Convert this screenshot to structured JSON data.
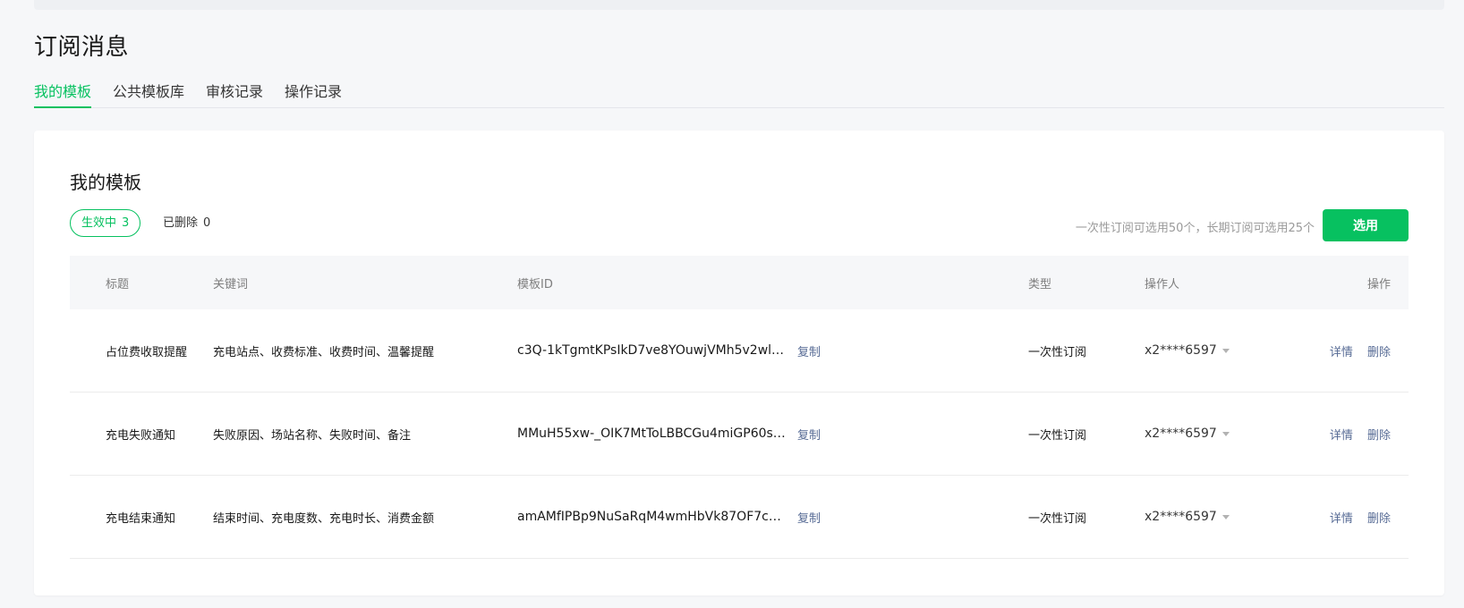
{
  "page": {
    "title": "订阅消息"
  },
  "tabs": [
    {
      "label": "我的模板",
      "active": true
    },
    {
      "label": "公共模板库",
      "active": false
    },
    {
      "label": "审核记录",
      "active": false
    },
    {
      "label": "操作记录",
      "active": false
    }
  ],
  "section": {
    "title": "我的模板",
    "filters": {
      "active": {
        "label": "生效中",
        "count": "3"
      },
      "deleted": {
        "label": "已删除",
        "count": "0"
      }
    },
    "quota_note": "一次性订阅可选用50个，长期订阅可选用25个",
    "select_button": "选用"
  },
  "table": {
    "headers": {
      "title": "标题",
      "keywords": "关键词",
      "template_id": "模板ID",
      "type": "类型",
      "operator": "操作人",
      "actions": "操作"
    },
    "copy_label": "复制",
    "detail_label": "详情",
    "delete_label": "删除",
    "rows": [
      {
        "title": "占位费收取提醒",
        "keywords": "充电站点、收费标准、收费时间、温馨提醒",
        "template_id": "c3Q-1kTgmtKPsIkD7ve8YOuwjVMh5v2wlk…",
        "type": "一次性订阅",
        "operator": "x2****6597"
      },
      {
        "title": "充电失败通知",
        "keywords": "失败原因、场站名称、失败时间、备注",
        "template_id": "MMuH55xw-_OIK7MtToLBBCGu4miGP60s…",
        "type": "一次性订阅",
        "operator": "x2****6597"
      },
      {
        "title": "充电结束通知",
        "keywords": "结束时间、充电度数、充电时长、消费金额",
        "template_id": "amAMfIPBp9NuSaRqM4wmHbVk87OF7cM…",
        "type": "一次性订阅",
        "operator": "x2****6597"
      }
    ]
  },
  "colors": {
    "accent": "#07c160",
    "link": "#576b95"
  }
}
